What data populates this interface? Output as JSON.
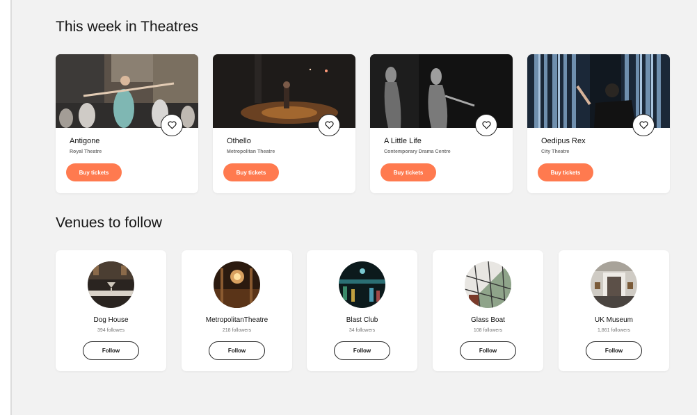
{
  "sections": {
    "theatres_title": "This week in Theatres",
    "venues_title": "Venues to follow"
  },
  "accent_color": "#ff7a4f",
  "events": [
    {
      "title": "Antigone",
      "venue": "Royal Theatre",
      "button": "Buy tickets",
      "fav_icon": "heart-icon"
    },
    {
      "title": "Othello",
      "venue": "Metropolitan Theatre",
      "button": "Buy tickets",
      "fav_icon": "heart-icon"
    },
    {
      "title": "A Little Life",
      "venue": "Contemporary Drama Centre",
      "button": "Buy tickets",
      "fav_icon": "heart-icon"
    },
    {
      "title": "Oedipus Rex",
      "venue": "City Theatre",
      "button": "Buy tickets",
      "fav_icon": "heart-icon"
    }
  ],
  "venues": [
    {
      "name": "Dog House",
      "followers": "394 followes",
      "button": "Follow"
    },
    {
      "name": "MetropolitanTheatre",
      "followers": "218 followers",
      "button": "Follow"
    },
    {
      "name": "Blast Club",
      "followers": "34 followers",
      "button": "Follow"
    },
    {
      "name": "Glass Boat",
      "followers": "108 followers",
      "button": "Follow"
    },
    {
      "name": "UK Museum",
      "followers": "1,861 followers",
      "button": "Follow"
    }
  ]
}
